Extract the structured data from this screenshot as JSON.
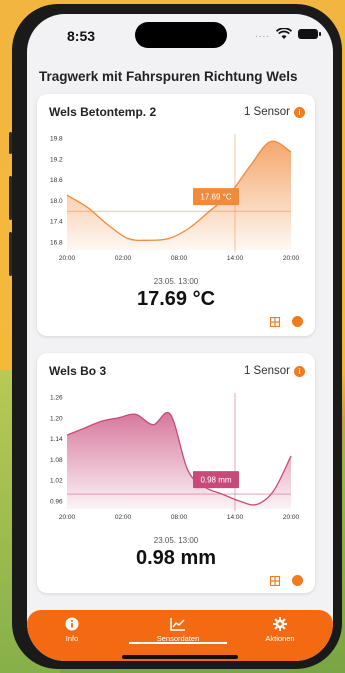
{
  "status_bar": {
    "time": "8:53",
    "dots": "...."
  },
  "page": {
    "title": "Tragwerk mit Fahrspuren Richtung Wels"
  },
  "colors": {
    "accent": "#f47a20",
    "chart1": "#f08a3c",
    "chart2": "#c94a7a"
  },
  "cards": [
    {
      "title": "Wels Betontemp. 2",
      "sensor_label": "1 Sensor",
      "timestamp": "23.05. 13:00",
      "value": "17.69 °C",
      "tooltip": "17.69 °C",
      "chart_data": {
        "type": "area",
        "x": [
          "20:00",
          "02:00",
          "08:00",
          "14:00",
          "20:00"
        ],
        "y_ticks": [
          "19.8",
          "19.2",
          "18.6",
          "18.0",
          "17.4",
          "16.8"
        ],
        "ylim": [
          16.8,
          19.8
        ],
        "series": [
          {
            "values": [
              18.15,
              17.8,
              17.3,
              16.9,
              16.85,
              16.9,
              17.2,
              17.69,
              18.2,
              19.0,
              19.7,
              19.4
            ]
          }
        ],
        "crosshair": {
          "x": "14:00",
          "y": 17.69
        }
      }
    },
    {
      "title": "Wels Bo 3",
      "sensor_label": "1 Sensor",
      "timestamp": "23.05. 13:00",
      "value": "0.98 mm",
      "tooltip": "0.98 mm",
      "chart_data": {
        "type": "area",
        "x": [
          "20:00",
          "02:00",
          "08:00",
          "14:00",
          "20:00"
        ],
        "y_ticks": [
          "1.26",
          "1.20",
          "1.14",
          "1.08",
          "1.02",
          "0.96"
        ],
        "ylim": [
          0.96,
          1.26
        ],
        "series": [
          {
            "values": [
              1.15,
              1.17,
              1.19,
              1.2,
              1.21,
              1.18,
              1.21,
              1.05,
              1.0,
              0.98,
              0.96,
              0.95,
              0.99,
              1.09
            ]
          }
        ],
        "crosshair": {
          "x": "14:00",
          "y": 0.98
        }
      }
    }
  ],
  "tabs": [
    {
      "label": "Info",
      "icon": "info-icon"
    },
    {
      "label": "Sensordaten",
      "icon": "chart-icon"
    },
    {
      "label": "Aktionen",
      "icon": "gear-icon"
    }
  ]
}
